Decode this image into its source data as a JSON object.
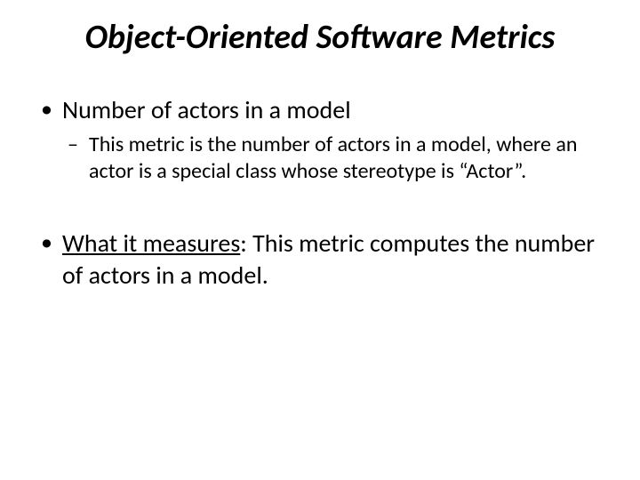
{
  "title": "Object-Oriented Software Metrics",
  "bullets": [
    {
      "text": "Number of actors in a model",
      "sub": [
        "This metric is the number of actors in a model, where an actor is a special class whose stereotype is “Actor”."
      ]
    },
    {
      "lead": "What it measures",
      "rest": ": This metric computes the number of actors in a model."
    }
  ]
}
